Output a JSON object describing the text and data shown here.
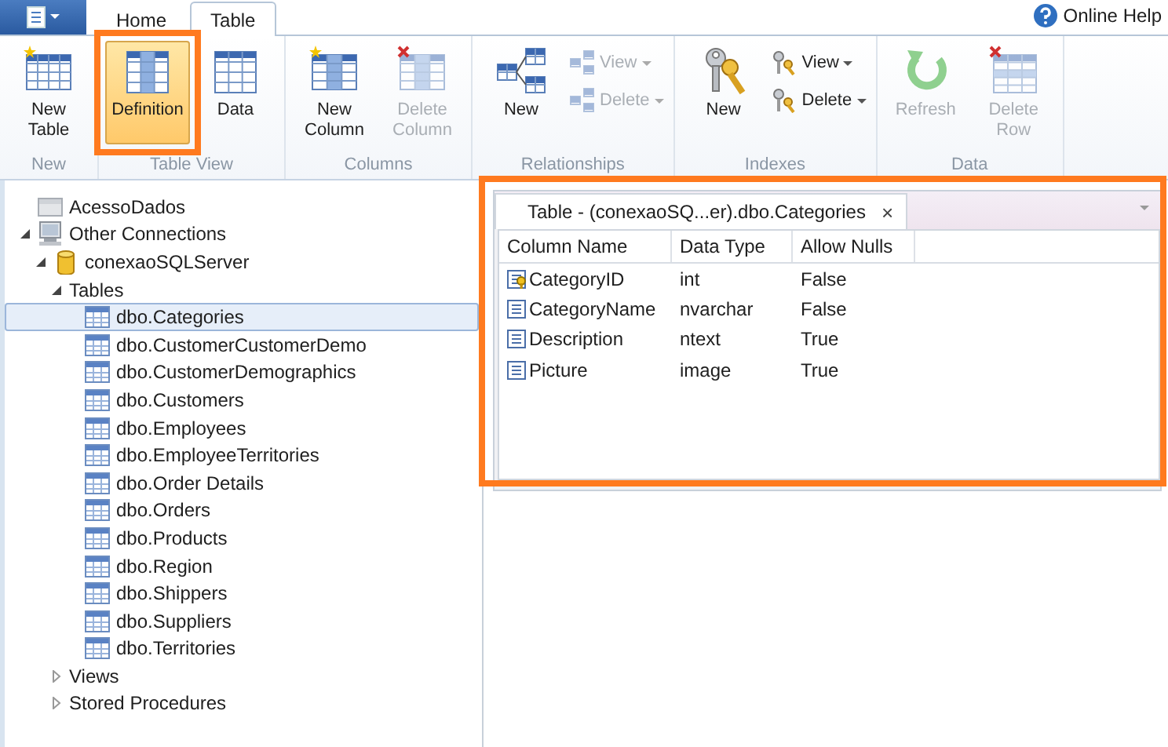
{
  "menu_tabs": [
    {
      "label": "Home",
      "selected": false
    },
    {
      "label": "Table",
      "selected": true
    }
  ],
  "help_link": "Online Help",
  "ribbon": {
    "groups": [
      {
        "label": "New",
        "buttons": [
          {
            "kind": "large",
            "label": "New Table",
            "disabled": false
          }
        ]
      },
      {
        "label": "Table View",
        "buttons": [
          {
            "kind": "large",
            "label": "Definition",
            "disabled": false,
            "selected": true
          },
          {
            "kind": "large",
            "label": "Data",
            "disabled": false,
            "selected": false
          }
        ]
      },
      {
        "label": "Columns",
        "buttons": [
          {
            "kind": "large",
            "label": "New Column",
            "disabled": false
          },
          {
            "kind": "large",
            "label": "Delete Column",
            "disabled": true
          }
        ]
      },
      {
        "label": "Relationships",
        "buttons": [
          {
            "kind": "large",
            "label": "New",
            "disabled": false
          },
          {
            "kind": "small",
            "label": "View",
            "disabled": true
          },
          {
            "kind": "small",
            "label": "Delete",
            "disabled": true
          }
        ]
      },
      {
        "label": "Indexes",
        "buttons": [
          {
            "kind": "large",
            "label": "New",
            "disabled": false
          },
          {
            "kind": "small",
            "label": "View",
            "disabled": false
          },
          {
            "kind": "small",
            "label": "Delete",
            "disabled": false
          }
        ]
      },
      {
        "label": "Data",
        "buttons": [
          {
            "kind": "large",
            "label": "Refresh",
            "disabled": true
          },
          {
            "kind": "large",
            "label": "Delete Row",
            "disabled": true
          }
        ]
      }
    ]
  },
  "tree": [
    {
      "label": "AcessoDados",
      "kind": "folder",
      "selected": false
    },
    {
      "label": "Other Connections",
      "kind": "server",
      "expanded": true,
      "selected": false,
      "children": [
        {
          "label": "conexaoSQLServer",
          "kind": "database",
          "expanded": true,
          "selected": false,
          "children": [
            {
              "label": "Tables",
              "expanded": true,
              "selected": false,
              "children": [
                {
                  "label": "dbo.Categories",
                  "kind": "table",
                  "selected": true
                },
                {
                  "label": "dbo.CustomerCustomerDemo",
                  "kind": "table",
                  "selected": false
                },
                {
                  "label": "dbo.CustomerDemographics",
                  "kind": "table",
                  "selected": false
                },
                {
                  "label": "dbo.Customers",
                  "kind": "table",
                  "selected": false
                },
                {
                  "label": "dbo.Employees",
                  "kind": "table",
                  "selected": false
                },
                {
                  "label": "dbo.EmployeeTerritories",
                  "kind": "table",
                  "selected": false
                },
                {
                  "label": "dbo.Order Details",
                  "kind": "table",
                  "selected": false
                },
                {
                  "label": "dbo.Orders",
                  "kind": "table",
                  "selected": false
                },
                {
                  "label": "dbo.Products",
                  "kind": "table",
                  "selected": false
                },
                {
                  "label": "dbo.Region",
                  "kind": "table",
                  "selected": false
                },
                {
                  "label": "dbo.Shippers",
                  "kind": "table",
                  "selected": false
                },
                {
                  "label": "dbo.Suppliers",
                  "kind": "table",
                  "selected": false
                },
                {
                  "label": "dbo.Territories",
                  "kind": "table",
                  "selected": false
                }
              ]
            },
            {
              "label": "Views",
              "expanded": false,
              "selected": false
            },
            {
              "label": "Stored Procedures",
              "expanded": false,
              "selected": false
            }
          ]
        }
      ]
    }
  ],
  "document": {
    "tab_title": "Table - (conexaoSQ...er).dbo.Categories",
    "close": "×",
    "columns": [
      "Column Name",
      "Data Type",
      "Allow Nulls"
    ],
    "rows": [
      {
        "kind": "key",
        "cells": [
          "CategoryID",
          "int",
          "False"
        ]
      },
      {
        "kind": "column",
        "cells": [
          "CategoryName",
          "nvarchar",
          "False"
        ]
      },
      {
        "kind": "column",
        "cells": [
          "Description",
          "ntext",
          "True"
        ]
      },
      {
        "kind": "column",
        "cells": [
          "Picture",
          "image",
          "True"
        ]
      }
    ]
  }
}
